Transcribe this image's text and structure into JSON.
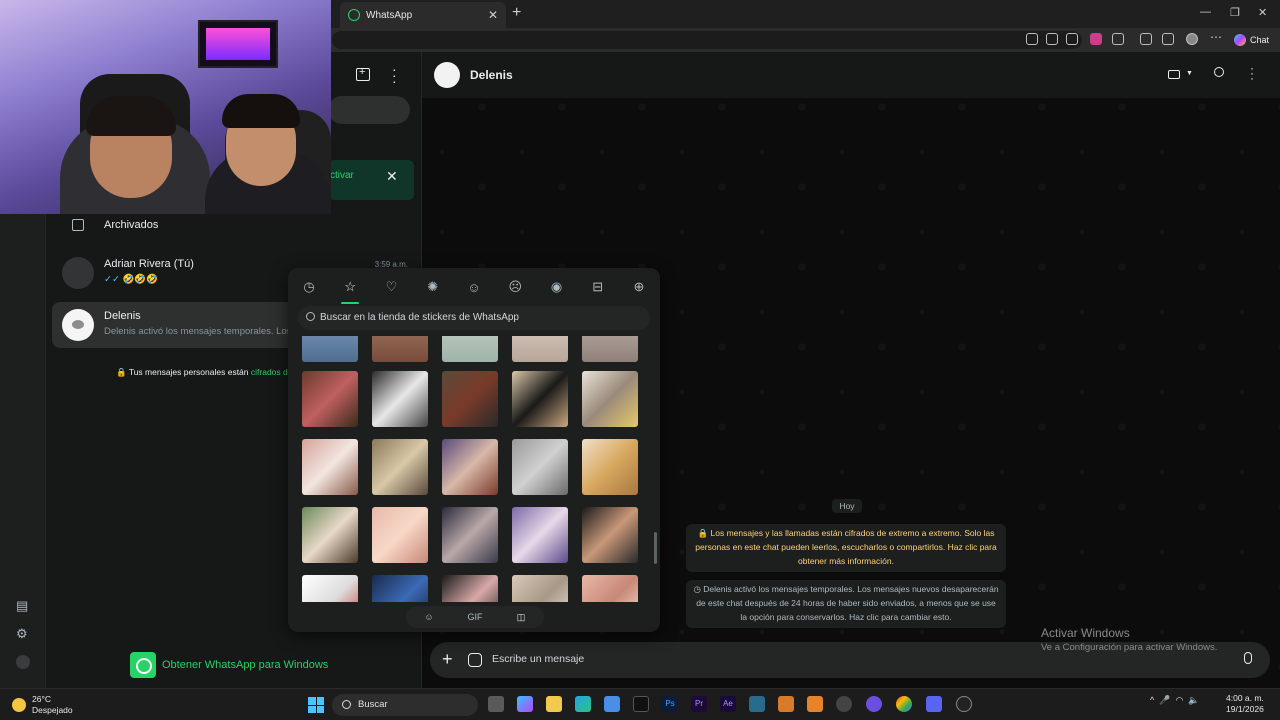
{
  "browser": {
    "tab_title": "WhatsApp",
    "chat_button_label": "Chat"
  },
  "list": {
    "notification_text": "ctivar",
    "archived_label": "Archivados",
    "chats": [
      {
        "name": "Adrian Rivera (Tú)",
        "preview": "🤣🤣🤣",
        "time": "3:59 a.m."
      },
      {
        "name": "Delenis",
        "preview": "Delenis activó los mensajes temporales. Los",
        "time": ""
      }
    ],
    "encryption_note": "Tus mensajes personales están",
    "encryption_link": "cifrados de e",
    "promo_label": "Obtener WhatsApp para Windows"
  },
  "chat": {
    "contact_name": "Delenis",
    "date_chip": "Hoy",
    "system_message_1": "Los mensajes y las llamadas están cifrados de extremo a extremo. Solo las personas en este chat pueden leerlos, escucharlos o compartirlos. Haz clic para obtener más información.",
    "system_message_2": "Delenis activó los mensajes temporales. Los mensajes nuevos desaparecerán de este chat después de 24 horas de haber sido enviados, a menos que se use la opción para conservarlos. Haz clic para cambiar esto.",
    "composer_placeholder": "Escribe un mensaje"
  },
  "sticker_panel": {
    "search_placeholder": "Buscar en la tienda de stickers de WhatsApp",
    "categories": [
      "recent-icon",
      "favorites-icon",
      "love-icon",
      "celebrate-icon",
      "happy-icon",
      "sad-icon",
      "angry-icon",
      "gift-icon",
      "add-icon"
    ],
    "active_category": "favorites-icon",
    "bottom_tabs": [
      "emoji",
      "GIF",
      "sticker"
    ],
    "active_bottom_tab": "sticker",
    "gif_label": "GIF"
  },
  "watermark": {
    "line1": "Activar Windows",
    "line2": "Ve a Configuración para activar Windows."
  },
  "taskbar": {
    "temperature": "26°C",
    "weather": "Despejado",
    "search_label": "Buscar",
    "time": "4:00 a. m.",
    "date": "19/1/2026"
  }
}
